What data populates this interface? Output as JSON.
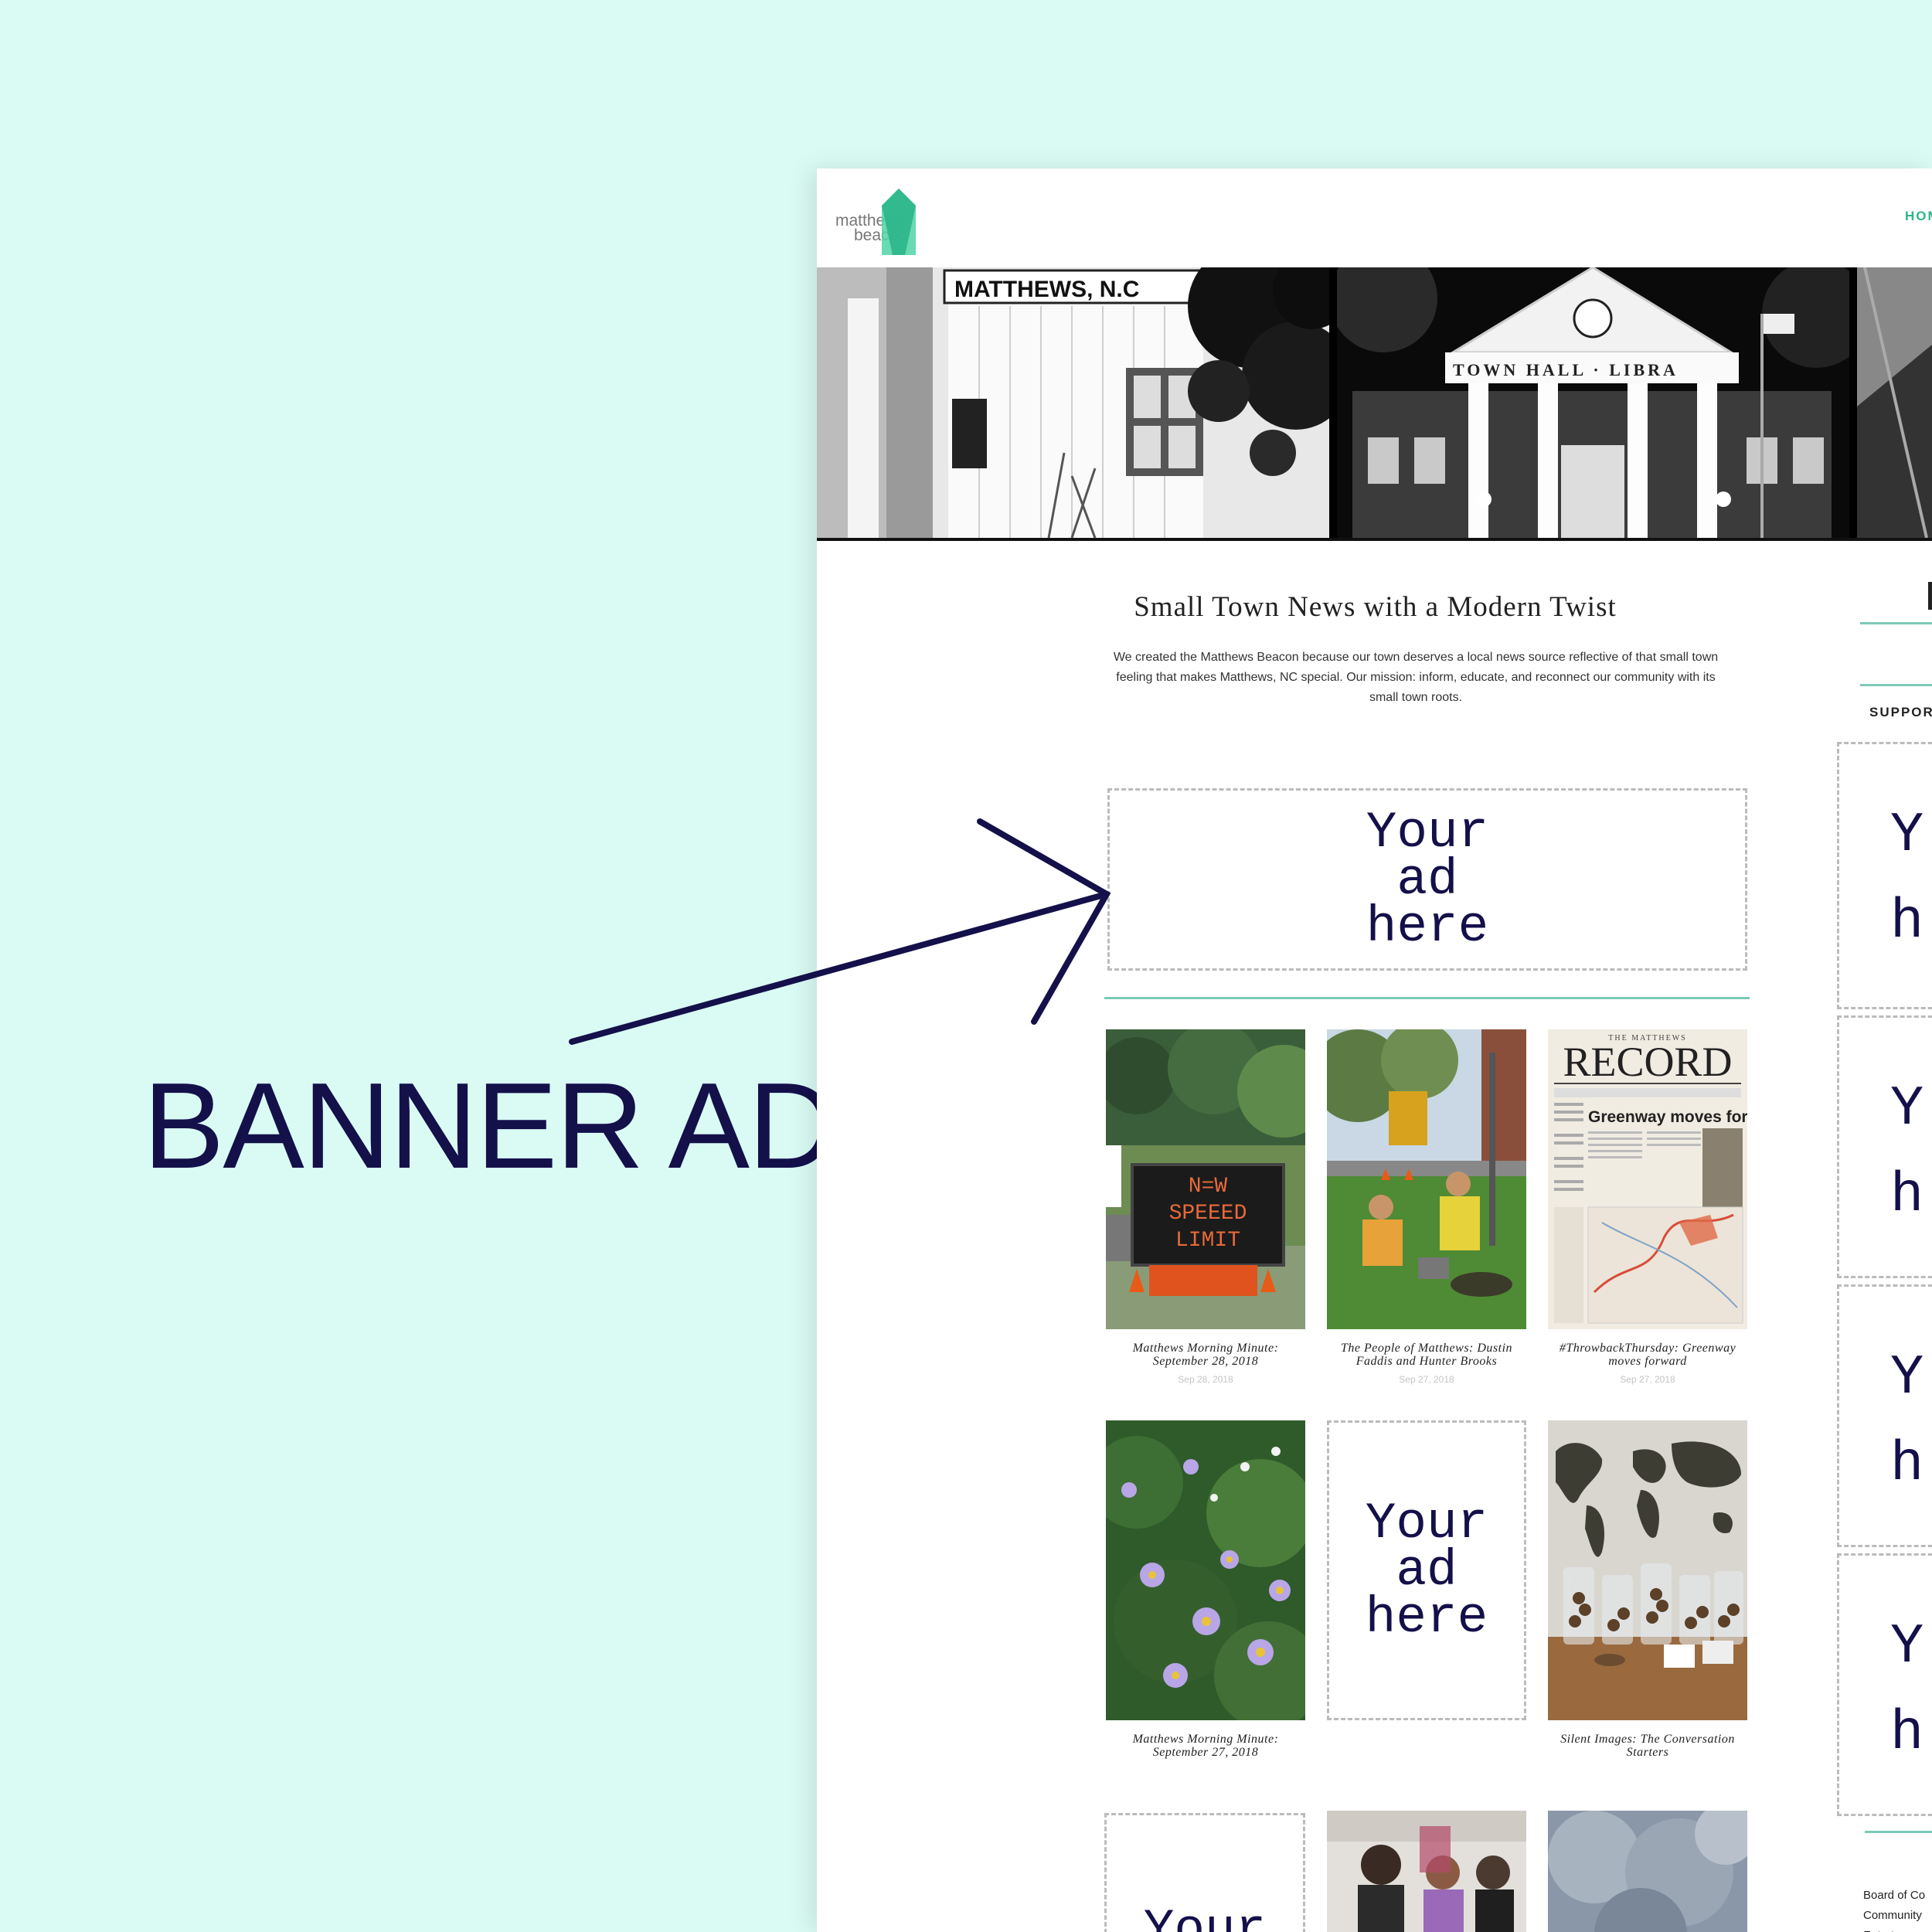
{
  "annotation": {
    "label": "BANNER AD"
  },
  "site": {
    "logo_line1": "matthews",
    "logo_line2": "beacon",
    "nav": {
      "home": "HOM"
    },
    "hero_sign": "MATTHEWS, N.C",
    "hero_building": "TOWN HALL · LIBRA"
  },
  "intro": {
    "title": "Small Town News with a Modern Twist",
    "body": "We created the Matthews Beacon because our town deserves a local news source reflective of that small town feeling that makes Matthews, NC special. Our mission: inform, educate, and reconnect our community with its small town roots."
  },
  "ads": {
    "banner": "Your\nad\nhere",
    "grid": "Your\nad\nhere",
    "grid_partial": "Your"
  },
  "posts": [
    {
      "title": "Matthews Morning Minute: September 28, 2018",
      "date": "Sep 28, 2018",
      "sign_text": "NEW SPEEED LIMIT"
    },
    {
      "title": "The People of Matthews: Dustin Faddis and Hunter Brooks",
      "date": "Sep 27, 2018"
    },
    {
      "title": "#ThrowbackThursday: Greenway moves forward",
      "date": "Sep 27, 2018",
      "paper_name": "RECORD",
      "paper_tag": "THE MATTHEWS",
      "paper_headline": "Greenway moves forward"
    },
    {
      "title": "Matthews Morning Minute: September 27, 2018"
    },
    {
      "title": "Silent Images: The Conversation Starters"
    }
  ],
  "sidebar": {
    "support": "SUPPOR",
    "ad_text": "Y\nh",
    "links": [
      "Board of Co",
      "Community",
      "Entert"
    ]
  },
  "colors": {
    "accent": "#2cb58a",
    "rule": "#7cc9b8",
    "ink": "#14104a",
    "background": "#dafaf4"
  }
}
